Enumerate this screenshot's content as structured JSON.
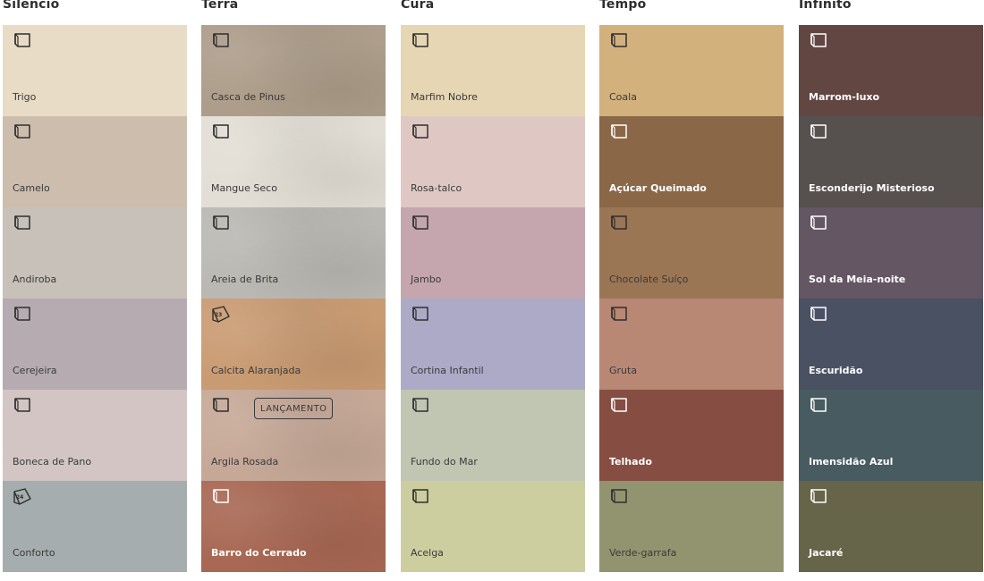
{
  "columns": [
    {
      "title": "Silêncio",
      "swatches": [
        {
          "label": "Trigo",
          "color": "#e9dcc6",
          "tone": "light",
          "icon": "card-icon"
        },
        {
          "label": "Camelo",
          "color": "#cdbdad",
          "tone": "light",
          "icon": "card-icon"
        },
        {
          "label": "Andiroba",
          "color": "#c8c1b9",
          "tone": "light",
          "icon": "card-icon"
        },
        {
          "label": "Cerejeira",
          "color": "#b6abb1",
          "tone": "light",
          "icon": "card-icon"
        },
        {
          "label": "Boneca de Pano",
          "color": "#d2c5c3",
          "tone": "light",
          "icon": "card-icon"
        },
        {
          "label": "Conforto",
          "color": "#a5adae",
          "tone": "light",
          "icon": "calendar-24-icon"
        }
      ]
    },
    {
      "title": "Terra",
      "swatches": [
        {
          "label": "Casca de Pinus",
          "color": "#ad9d8a",
          "tone": "light",
          "icon": "card-icon",
          "textured": true
        },
        {
          "label": "Mangue Seco",
          "color": "#e2ded5",
          "tone": "light",
          "icon": "card-icon",
          "textured": true
        },
        {
          "label": "Areia de Brita",
          "color": "#bab8b3",
          "tone": "light",
          "icon": "card-icon",
          "textured": true
        },
        {
          "label": "Calcita Alaranjada",
          "color": "#c99b72",
          "tone": "light",
          "icon": "calendar-23-icon",
          "textured": true
        },
        {
          "label": "Argila Rosada",
          "color": "#c6a897",
          "tone": "light",
          "icon": "card-icon",
          "textured": true,
          "badge": "LANÇAMENTO"
        },
        {
          "label": "Barro do Cerrado",
          "color": "#a86853",
          "tone": "dark",
          "icon": "card-icon",
          "textured": true
        }
      ]
    },
    {
      "title": "Cura",
      "swatches": [
        {
          "label": "Marfim Nobre",
          "color": "#e6d6b3",
          "tone": "light",
          "icon": "card-icon"
        },
        {
          "label": "Rosa-talco",
          "color": "#dfc8c4",
          "tone": "light",
          "icon": "card-icon"
        },
        {
          "label": "Jambo",
          "color": "#c5a6ae",
          "tone": "light",
          "icon": "card-icon"
        },
        {
          "label": "Cortina Infantil",
          "color": "#adaac8",
          "tone": "light",
          "icon": "card-icon"
        },
        {
          "label": "Fundo do Mar",
          "color": "#c0c6b2",
          "tone": "light",
          "icon": "card-icon"
        },
        {
          "label": "Acelga",
          "color": "#cdce9f",
          "tone": "light",
          "icon": "card-icon"
        }
      ]
    },
    {
      "title": "Tempo",
      "swatches": [
        {
          "label": "Coala",
          "color": "#d2b17d",
          "tone": "light",
          "icon": "card-icon"
        },
        {
          "label": "Açúcar Queimado",
          "color": "#8a6746",
          "tone": "dark",
          "icon": "card-icon"
        },
        {
          "label": "Chocolate Suíço",
          "color": "#9a7655",
          "tone": "light",
          "icon": "card-icon"
        },
        {
          "label": "Gruta",
          "color": "#b88874",
          "tone": "light",
          "icon": "card-icon"
        },
        {
          "label": "Telhado",
          "color": "#864d43",
          "tone": "dark",
          "icon": "card-icon"
        },
        {
          "label": "Verde-garrafa",
          "color": "#92946f",
          "tone": "light",
          "icon": "card-icon"
        }
      ]
    },
    {
      "title": "Infinito",
      "swatches": [
        {
          "label": "Marrom-luxo",
          "color": "#624642",
          "tone": "dark",
          "icon": "card-icon"
        },
        {
          "label": "Esconderijo Misterioso",
          "color": "#56504f",
          "tone": "dark",
          "icon": "card-icon"
        },
        {
          "label": "Sol da Meia-noite",
          "color": "#645663",
          "tone": "dark",
          "icon": "card-icon"
        },
        {
          "label": "Escuridão",
          "color": "#4a5163",
          "tone": "dark",
          "icon": "card-icon"
        },
        {
          "label": "Imensidão Azul",
          "color": "#475b60",
          "tone": "dark",
          "icon": "card-icon"
        },
        {
          "label": "Jacaré",
          "color": "#666449",
          "tone": "dark",
          "icon": "card-icon"
        }
      ]
    }
  ]
}
